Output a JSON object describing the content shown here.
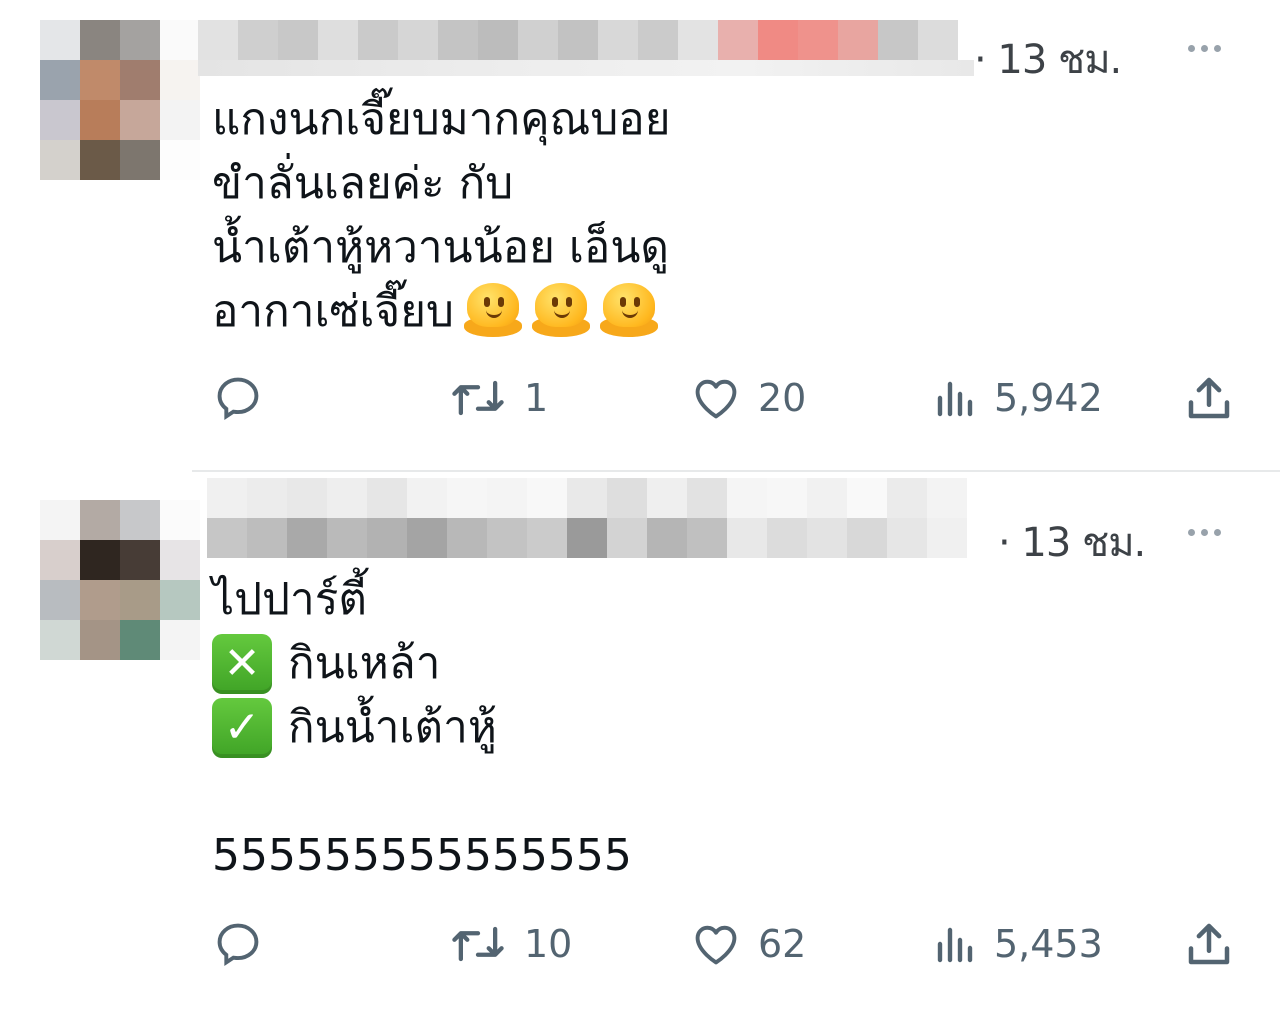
{
  "tweets": [
    {
      "time": "· 13 ชม.",
      "text_lines": [
        "แกงนกเจี๊ยบมากคุณบอย",
        "ขำลั่นเลยค่ะ กับ",
        "น้ำเต้าหู้หวานน้อย เอ็นดู",
        "อากาเซ่เจี๊ยบ"
      ],
      "emoji": "melting-face-emoji",
      "stats": {
        "replies": "",
        "retweets": "1",
        "likes": "20",
        "views": "5,942"
      }
    },
    {
      "time": "· 13 ชม.",
      "text_lines": [
        "ไปปาร์ตี้",
        "กินเหล้า",
        "กินน้ำเต้าหู้",
        "",
        "555555555555555"
      ],
      "icons": [
        "cross-mark-button-icon",
        "check-mark-button-icon"
      ],
      "stats": {
        "replies": "",
        "retweets": "10",
        "likes": "62",
        "views": "5,453"
      }
    }
  ],
  "colors": {
    "text": "#0f1419",
    "muted": "#536471",
    "divider": "#e7e9ea",
    "check_green": "#4ab532"
  }
}
